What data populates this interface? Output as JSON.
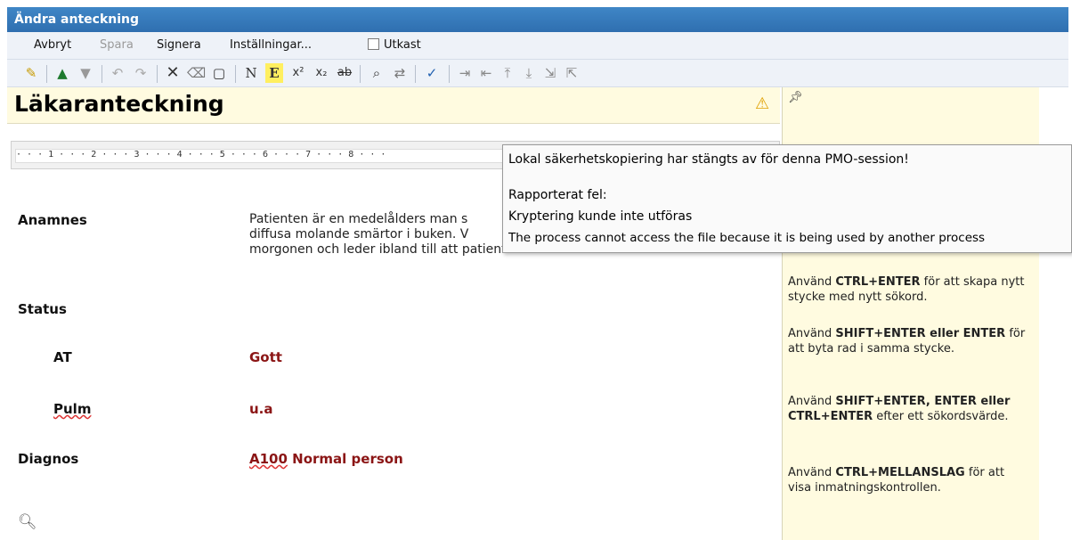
{
  "window": {
    "title": "Ändra anteckning"
  },
  "menu": {
    "cancel": "Avbryt",
    "save": "Spara",
    "sign": "Signera",
    "settings": "Inställningar...",
    "draft": "Utkast"
  },
  "toolbar": {
    "normal_label": "N",
    "emphasis_label": "E",
    "superscript_label": "x²",
    "subscript_label": "x₂",
    "strike_label": "ab"
  },
  "note": {
    "heading": "Läkaranteckning",
    "ruler_text": "· · · 1 · · · 2 · · · 3 · · · 4 · · · 5 · · · 6 · · · 7 · · · 8 · · ·",
    "anamnes_label": "Anamnes",
    "anamnes_text_1": "Patienten är en medelålders man s",
    "anamnes_text_2": "diffusa molande smärtor i buken. V",
    "anamnes_text_3": "morgonen och leder ibland till att patienten vaknar.",
    "status_label": "Status",
    "at_label": "AT",
    "at_value": "Gott",
    "pulm_label": "Pulm",
    "pulm_value": "u.a",
    "diagnos_label": "Diagnos",
    "diagnos_code": "A100",
    "diagnos_text": "Normal person"
  },
  "tooltip": {
    "line1": "Lokal säkerhetskopiering har stängts av för denna PMO-session!",
    "line2": "Rapporterat fel:",
    "line3": "Kryptering kunde inte utföras",
    "line4": "The process cannot access the file because it is being used by another process"
  },
  "help": {
    "tip1_a": "Använd ",
    "tip1_b": "CTRL+ENTER",
    "tip1_c": " för att skapa nytt stycke med nytt sökord.",
    "tip2_a": "Använd ",
    "tip2_b": "SHIFT+ENTER eller ENTER",
    "tip2_c": " för att byta rad i samma stycke.",
    "tip3_a": "Använd ",
    "tip3_b": "SHIFT+ENTER, ENTER eller CTRL+ENTER",
    "tip3_c": " efter ett sökordsvärde.",
    "tip4_a": "Använd ",
    "tip4_b": "CTRL+MELLANSLAG",
    "tip4_c": " för att visa inmatningskontrollen."
  },
  "colors": {
    "title_bar": "#2f6fb0",
    "value_text": "#8b1515",
    "panel_bg": "#fffbe0",
    "warning": "#e0a000"
  },
  "icons": [
    "new-note-icon",
    "arrow-up-icon",
    "arrow-down-icon",
    "undo-icon",
    "redo-icon",
    "delete-icon",
    "clear-format-icon",
    "page-icon",
    "find-icon",
    "replace-icon",
    "spellcheck-icon",
    "warning-icon",
    "pin-icon",
    "search-icon"
  ]
}
